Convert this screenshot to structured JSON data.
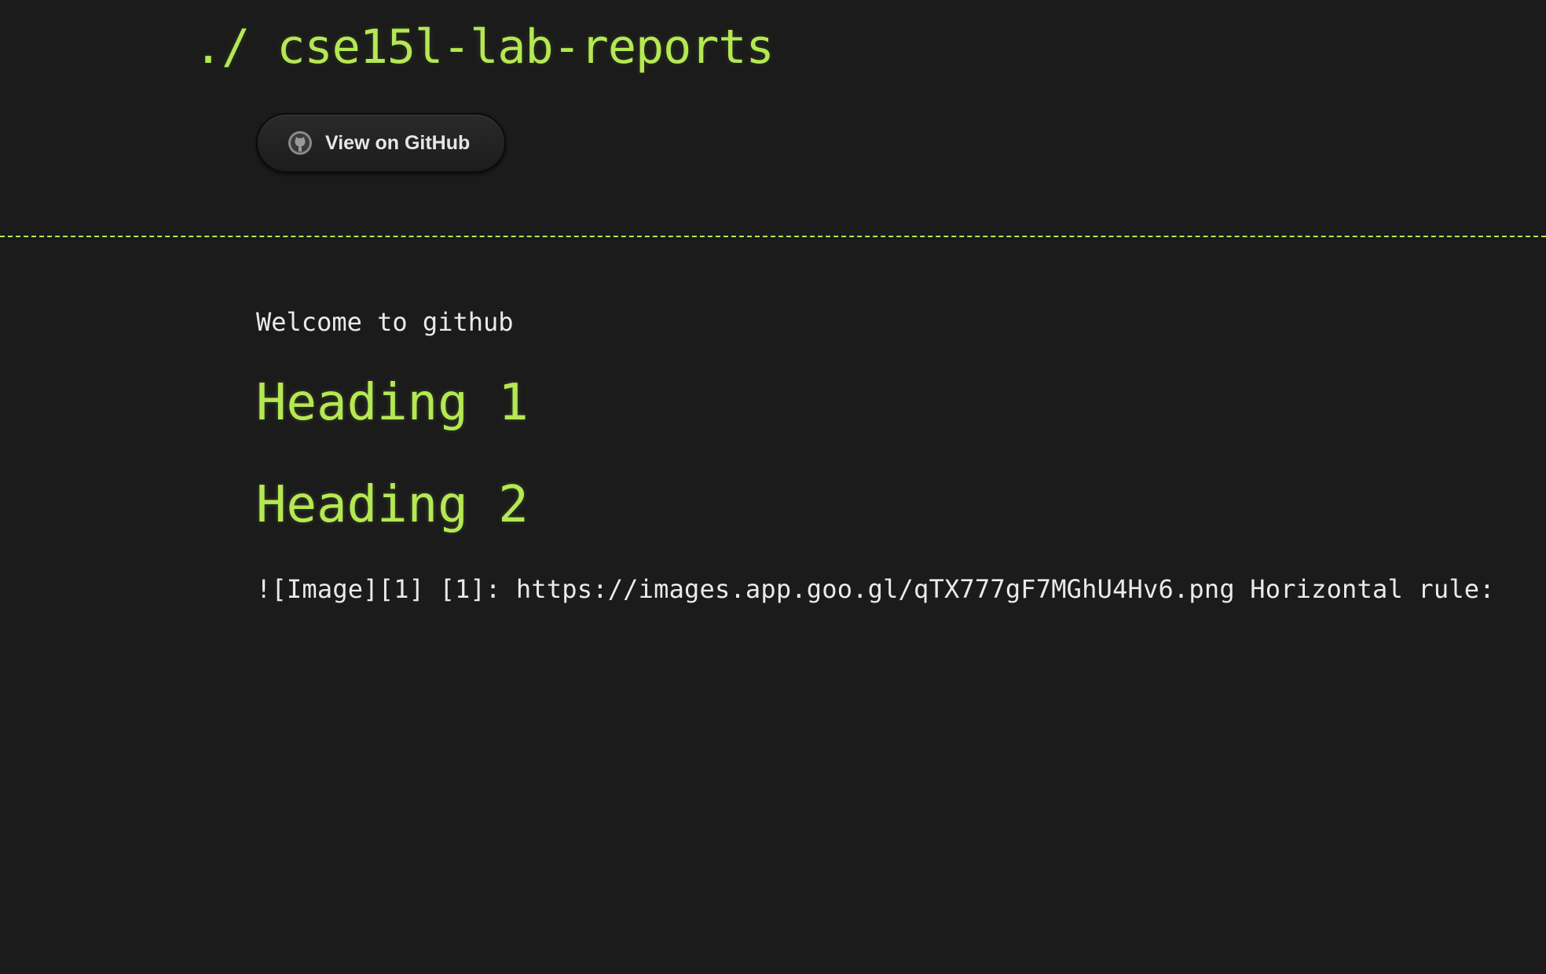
{
  "header": {
    "title_prefix": "./",
    "title": "cse15l-lab-reports",
    "github_button_label": "View on GitHub",
    "github_icon": "github-octocat-icon"
  },
  "main": {
    "welcome_text": "Welcome to github",
    "heading_1": "Heading 1",
    "heading_2": "Heading 2",
    "raw_markdown_text": "![Image][1] [1]: https://images.app.goo.gl/qTX777gF7MGhU4Hv6.png Horizontal rule:"
  },
  "colors": {
    "background": "#1b1b1b",
    "accent": "#b5e853",
    "text": "#eaeaea"
  }
}
